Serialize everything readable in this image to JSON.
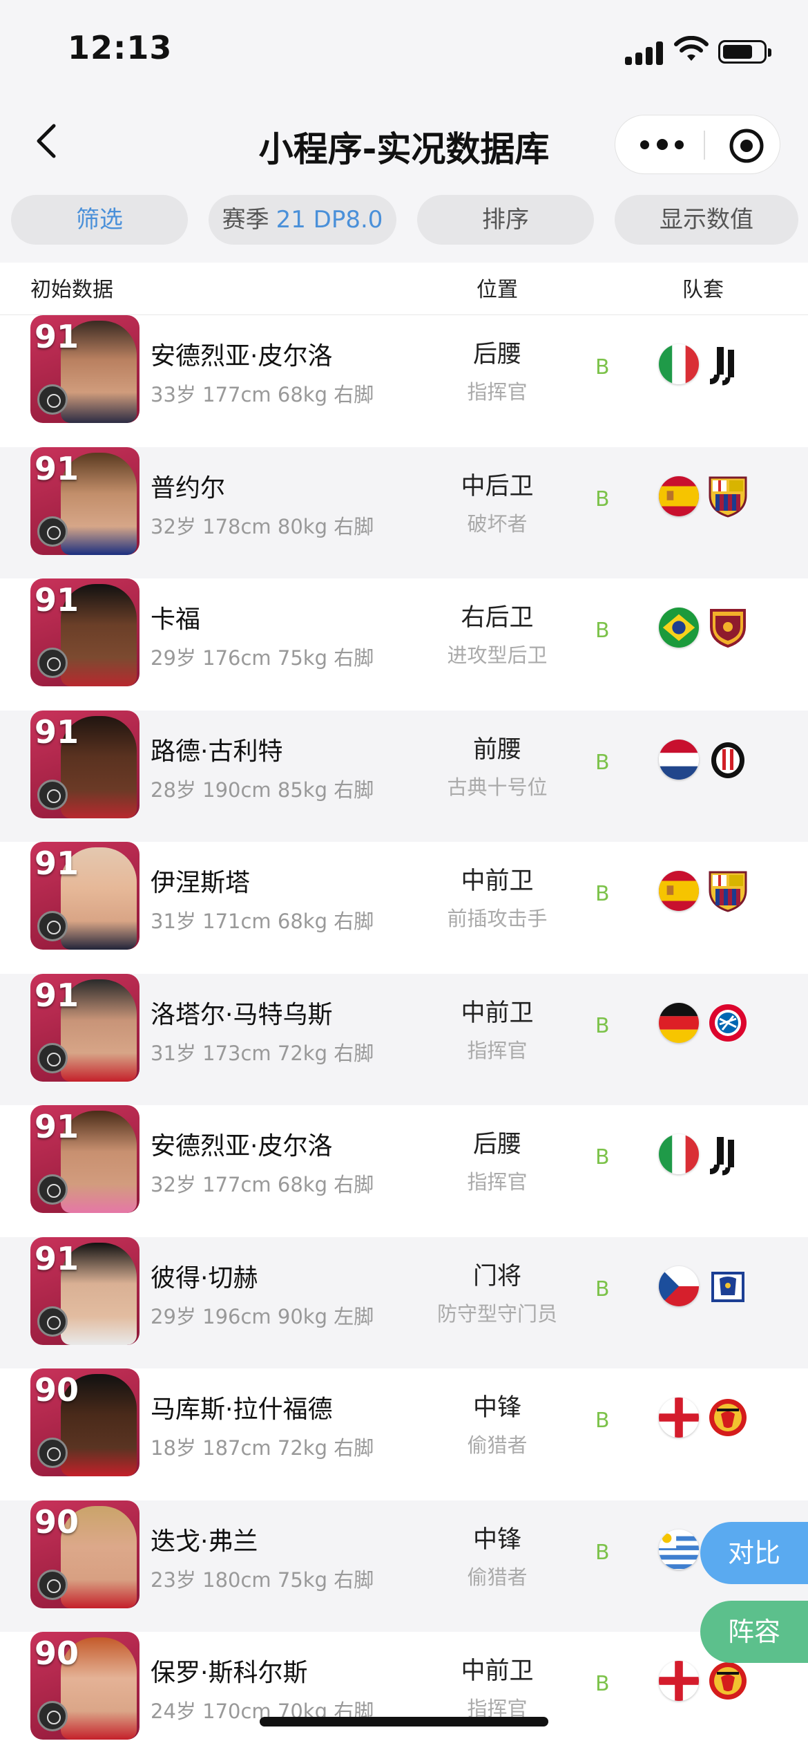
{
  "status_bar": {
    "time": "12:13"
  },
  "nav": {
    "title": "小程序-实况数据库"
  },
  "filters": {
    "filter_label": "筛选",
    "season_label": "赛季",
    "season_value": "21 DP8.0",
    "sort_label": "排序",
    "display_label": "显示数值"
  },
  "columns": {
    "initial": "初始数据",
    "position": "位置",
    "kit": "队套"
  },
  "players": [
    {
      "rating": "91",
      "name": "安德烈亚·皮尔洛",
      "info": "33岁 177cm 68kg 右脚",
      "position": "后腰",
      "role": "指挥官",
      "grade": "B",
      "flag": "italy",
      "club": "juventus"
    },
    {
      "rating": "91",
      "name": "普约尔",
      "info": "32岁 178cm 80kg 右脚",
      "position": "中后卫",
      "role": "破坏者",
      "grade": "B",
      "flag": "spain",
      "club": "barcelona"
    },
    {
      "rating": "91",
      "name": "卡福",
      "info": "29岁 176cm 75kg 右脚",
      "position": "右后卫",
      "role": "进攻型后卫",
      "grade": "B",
      "flag": "brazil",
      "club": "roma"
    },
    {
      "rating": "91",
      "name": "路德·古利特",
      "info": "28岁 190cm 85kg 右脚",
      "position": "前腰",
      "role": "古典十号位",
      "grade": "B",
      "flag": "netherlands",
      "club": "ac-milan"
    },
    {
      "rating": "91",
      "name": "伊涅斯塔",
      "info": "31岁 171cm 68kg 右脚",
      "position": "中前卫",
      "role": "前插攻击手",
      "grade": "B",
      "flag": "spain",
      "club": "barcelona"
    },
    {
      "rating": "91",
      "name": "洛塔尔·马特乌斯",
      "info": "31岁 173cm 72kg 右脚",
      "position": "中前卫",
      "role": "指挥官",
      "grade": "B",
      "flag": "germany",
      "club": "bayern"
    },
    {
      "rating": "91",
      "name": "安德烈亚·皮尔洛",
      "info": "32岁 177cm 68kg 右脚",
      "position": "后腰",
      "role": "指挥官",
      "grade": "B",
      "flag": "italy",
      "club": "juventus"
    },
    {
      "rating": "91",
      "name": "彼得·切赫",
      "info": "29岁 196cm 90kg 左脚",
      "position": "门将",
      "role": "防守型守门员",
      "grade": "B",
      "flag": "czech",
      "club": "chelsea"
    },
    {
      "rating": "90",
      "name": "马库斯·拉什福德",
      "info": "18岁 187cm 72kg 右脚",
      "position": "中锋",
      "role": "偷猎者",
      "grade": "B",
      "flag": "england",
      "club": "man-utd"
    },
    {
      "rating": "90",
      "name": "迭戈·弗兰",
      "info": "23岁 180cm 75kg 右脚",
      "position": "中锋",
      "role": "偷猎者",
      "grade": "B",
      "flag": "uruguay",
      "club": "man-utd"
    },
    {
      "rating": "90",
      "name": "保罗·斯科尔斯",
      "info": "24岁 170cm 70kg 右脚",
      "position": "中前卫",
      "role": "指挥官",
      "grade": "B",
      "flag": "england",
      "club": "man-utd"
    }
  ],
  "floating": {
    "compare": "对比",
    "lineup": "阵容"
  },
  "colors": {
    "accent_blue": "#4a90d9",
    "grade_green": "#7cc24a",
    "compare_bg": "#5aaaf0",
    "lineup_bg": "#5cc08c",
    "card_red": "#b5234a"
  }
}
